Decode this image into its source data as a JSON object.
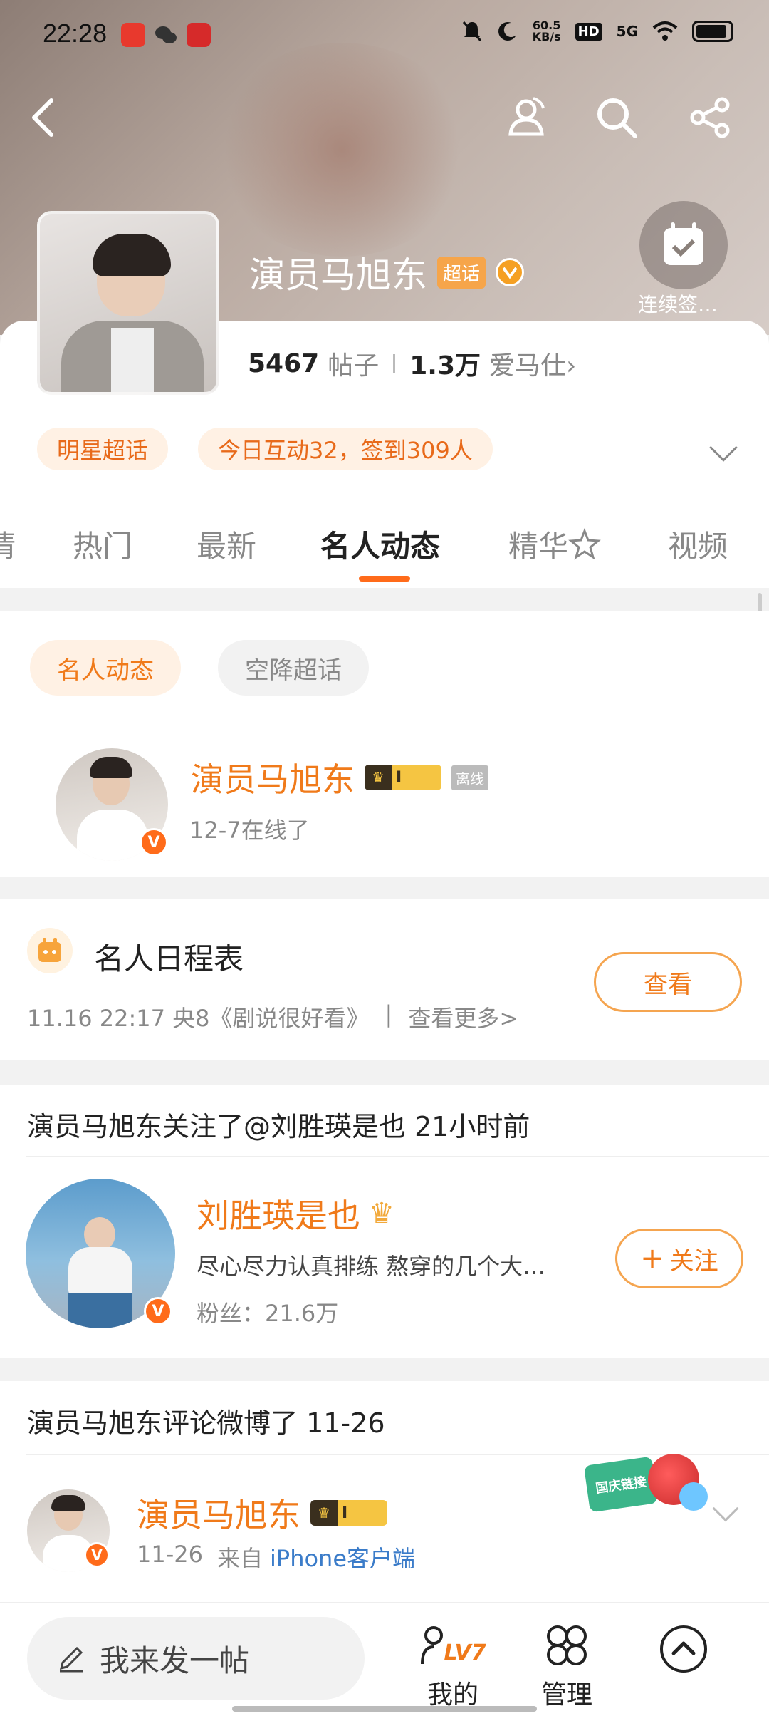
{
  "status_bar": {
    "time": "22:28",
    "network_speed": "60.5\nKB/s",
    "hd": "HD",
    "signal": "5G"
  },
  "header": {
    "name": "演员马旭东",
    "supertopic_tag": "超话",
    "checkin_label": "连续签…",
    "posts_count": "5467",
    "posts_label": "帖子",
    "fans_count": "1.3万",
    "fans_label": "爱马仕",
    "fans_chevron": "›"
  },
  "pills": {
    "category": "明星超话",
    "activity": "今日互动32，签到309人"
  },
  "tabs": [
    {
      "label": "情"
    },
    {
      "label": "热门"
    },
    {
      "label": "最新"
    },
    {
      "label": "名人动态"
    },
    {
      "label": "精华"
    },
    {
      "label": "视频"
    }
  ],
  "sub_tabs": {
    "active": "名人动态",
    "other": "空降超话"
  },
  "celebrity_card": {
    "name": "演员马旭东",
    "level": "I",
    "status_tag": "离线",
    "online_text": "12-7在线了",
    "v": "V"
  },
  "schedule": {
    "title": "名人日程表",
    "detail": "11.16 22:17 央8《剧说很好看》",
    "separator": "|",
    "more": "查看更多>",
    "button": "查看"
  },
  "follow_activity": {
    "header": "演员马旭东关注了@刘胜瑛是也 21小时前",
    "user_name": "刘胜瑛是也",
    "bio": "尽心尽力认真排练 熬穿的几个大…",
    "fans": "粉丝：21.6万",
    "follow_button": "关注",
    "follow_plus": "+",
    "v": "V"
  },
  "comment_activity": {
    "header": "演员马旭东评论微博了 11-26",
    "name": "演员马旭东",
    "level": "I",
    "date": "11-26",
    "source_prefix": "来自",
    "source": "iPhone客户端",
    "v": "V",
    "promo": "国庆链接"
  },
  "bottom_bar": {
    "post_placeholder": "我来发一帖",
    "mine_level": "LV7",
    "mine_label": "我的",
    "manage_label": "管理"
  },
  "colors": {
    "accent": "#f07a1a",
    "tab_underline": "#ff6b1a",
    "pill_bg": "#fff1e4"
  }
}
